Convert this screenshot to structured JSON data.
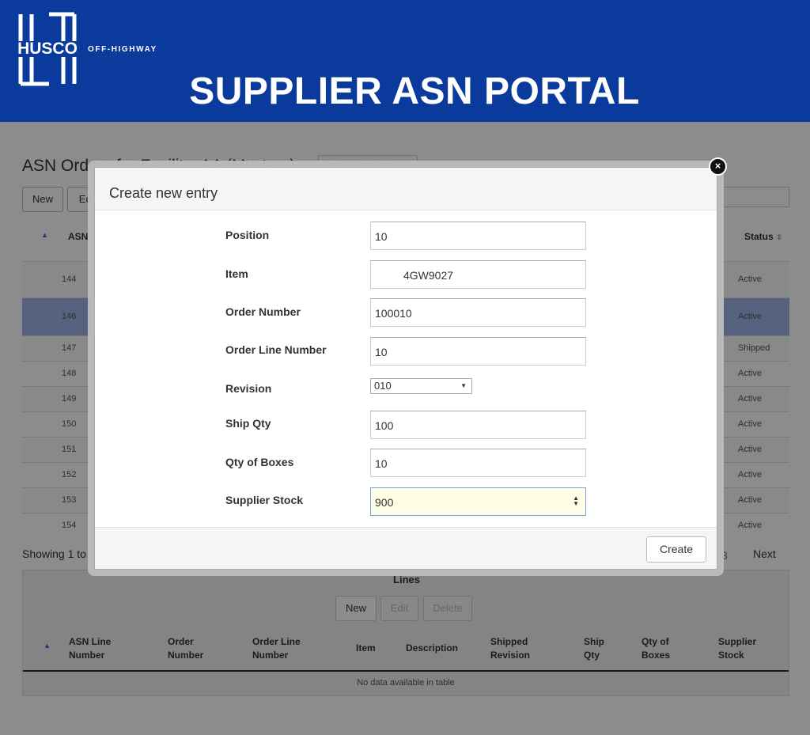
{
  "header": {
    "logo_text": "HUSCO",
    "logo_sub": "OFF-HIGHWAY",
    "title": "SUPPLIER ASN PORTAL"
  },
  "page": {
    "title": "ASN Orders for Facility: AA (Mystery)",
    "change_facility": "Change Facility",
    "toolbar": {
      "new": "New",
      "edit": "Edit"
    },
    "columns": {
      "asn": "ASN",
      "status": "Status"
    },
    "rows": [
      {
        "id": "144",
        "status": "Active"
      },
      {
        "id": "146",
        "status": "Active"
      },
      {
        "id": "147",
        "status": "Shipped"
      },
      {
        "id": "148",
        "status": "Active"
      },
      {
        "id": "149",
        "status": "Active"
      },
      {
        "id": "150",
        "status": "Active"
      },
      {
        "id": "151",
        "status": "Active"
      },
      {
        "id": "152",
        "status": "Active"
      },
      {
        "id": "153",
        "status": "Active"
      },
      {
        "id": "154",
        "status": "Active"
      }
    ],
    "showing": "Showing 1 to",
    "page_num": "3",
    "next": "Next"
  },
  "lines": {
    "title": "Lines",
    "buttons": {
      "new": "New",
      "edit": "Edit",
      "delete": "Delete"
    },
    "columns": [
      "ASN Line Number",
      "Order Number",
      "Order Line Number",
      "Item",
      "Description",
      "Shipped Revision",
      "Ship Qty",
      "Qty of Boxes",
      "Supplier Stock"
    ],
    "col_lines": [
      [
        "ASN Line",
        "Number"
      ],
      [
        "Order",
        "Number"
      ],
      [
        "Order Line",
        "Number"
      ],
      [
        "Item"
      ],
      [
        "Description"
      ],
      [
        "Shipped",
        "Revision"
      ],
      [
        "Ship",
        "Qty"
      ],
      [
        "Qty of",
        "Boxes"
      ],
      [
        "Supplier",
        "Stock"
      ]
    ],
    "empty": "No data available in table"
  },
  "modal": {
    "title": "Create new entry",
    "fields": {
      "position": {
        "label": "Position",
        "value": "10"
      },
      "item": {
        "label": "Item",
        "value": "4GW9027"
      },
      "order_number": {
        "label": "Order Number",
        "value": "100010"
      },
      "order_line_number": {
        "label": "Order Line Number",
        "value": "10"
      },
      "revision": {
        "label": "Revision",
        "value": "010"
      },
      "ship_qty": {
        "label": "Ship Qty",
        "value": "100"
      },
      "qty_of_boxes": {
        "label": "Qty of Boxes",
        "value": "10"
      },
      "supplier_stock": {
        "label": "Supplier Stock",
        "value": "900"
      }
    },
    "create": "Create",
    "close_glyph": "×"
  },
  "colors": {
    "header_bg": "#0a3a9c",
    "title_text": "#ffffff",
    "selected_row": "#9fb3e6",
    "focused_input": "#fefde6"
  },
  "icons": {
    "close": "close-icon",
    "sort": "sort-ascending-icon",
    "dropdown": "chevron-down-icon",
    "spinner": "number-spinner-icon"
  }
}
